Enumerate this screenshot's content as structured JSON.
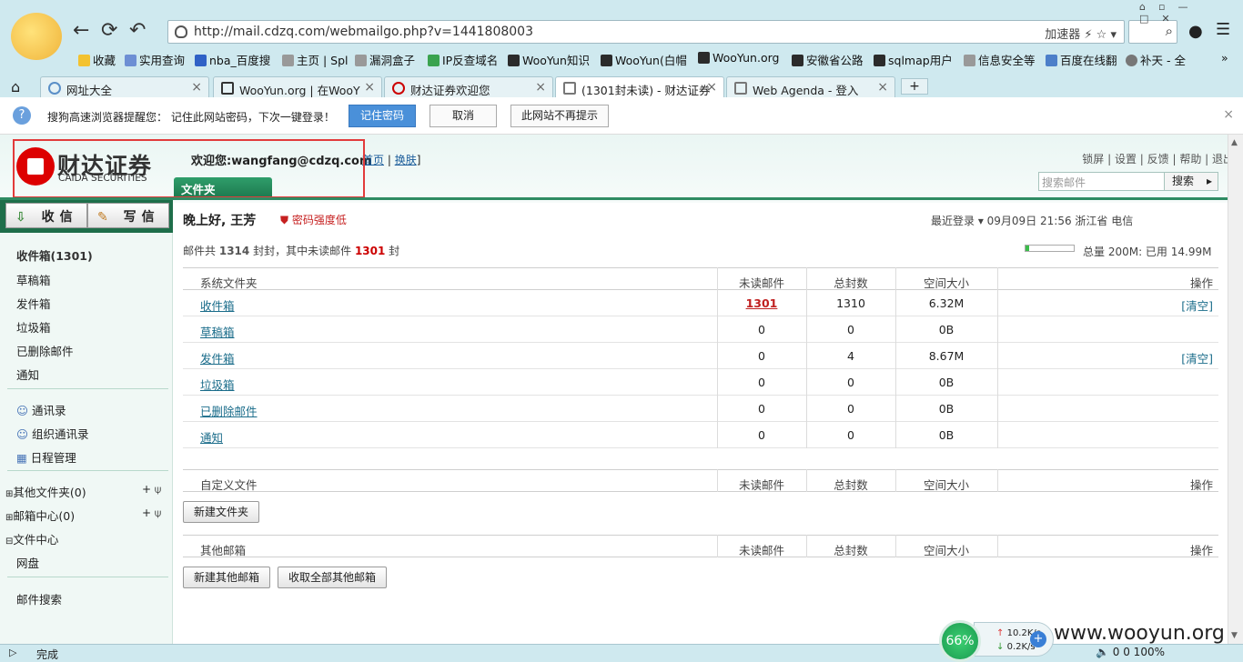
{
  "browser": {
    "url": "http://mail.cdzq.com/webmailgo.php?v=1441808003",
    "url_tools": "加速器 ⚡ ☆ ▾",
    "bookmarks": [
      "收藏",
      "实用查询",
      "nba_百度搜",
      "主页 | Spl",
      "漏洞盒子",
      "IP反查域名",
      "WooYun知识",
      "WooYun(白帽",
      "WooYun.org",
      "安徽省公路",
      "sqlmap用户",
      "信息安全等",
      "百度在线翻",
      "补天 - 全"
    ],
    "tabs": [
      {
        "label": "网址大全",
        "active": false
      },
      {
        "label": "WooYun.org | 在WooY",
        "active": false
      },
      {
        "label": "财达证券欢迎您",
        "active": false
      },
      {
        "label": "(1301封未读) - 财达证券",
        "active": true
      },
      {
        "label": "Web Agenda - 登入",
        "active": false
      }
    ],
    "notify": {
      "text": "搜狗高速浏览器提醒您：  记住此网站密码，下次一键登录！",
      "remember": "记住密码",
      "cancel": "取消",
      "never": "此网站不再提示"
    },
    "status": "完成",
    "net": {
      "percent": "66%",
      "up": "10.2K/s",
      "down": "0.2K/s"
    },
    "watermark": "www.wooyun.org",
    "status_right": "0   0   100%"
  },
  "header": {
    "logo_cn": "财达证券",
    "logo_en": "CAIDA SECURITIES",
    "welcome": "欢迎您:wangfang@cdzq.com",
    "home_link": "首页",
    "skin_link": "换肤",
    "folder_tab": "文件夹",
    "links": "锁屏 | 设置 | 反馈 | 帮助 | 退出",
    "search_placeholder": "搜索邮件",
    "search_btn": "搜索"
  },
  "sidebar": {
    "receive": "收信",
    "write": "写信",
    "folders": [
      "收件箱(1301)",
      "草稿箱",
      "发件箱",
      "垃圾箱",
      "已删除邮件",
      "通知"
    ],
    "tools": [
      "通讯录",
      "组织通讯录",
      "日程管理"
    ],
    "others": [
      "其他文件夹(0)",
      "邮箱中心(0)",
      "文件中心",
      "网盘"
    ],
    "mail_search": "邮件搜索"
  },
  "main": {
    "greeting": "晚上好, 王芳",
    "pw_warning": "密码强度低",
    "last_login": "最近登录 ▾ 09月09日 21:56 浙江省 电信",
    "count_prefix": "邮件共",
    "count_total": "1314",
    "count_mid": "封，其中未读邮件",
    "count_unread": "1301",
    "count_suffix": "封",
    "quota": "总量 200M: 已用 14.99M",
    "quota_used_fraction": 0.075,
    "sys_header": [
      "系统文件夹",
      "未读邮件",
      "总封数",
      "空间大小",
      "操作"
    ],
    "sys_rows": [
      {
        "name": "收件箱",
        "unread": "1301",
        "total": "1310",
        "size": "6.32M",
        "op": "[清空]"
      },
      {
        "name": "草稿箱",
        "unread": "0",
        "total": "0",
        "size": "0B",
        "op": ""
      },
      {
        "name": "发件箱",
        "unread": "0",
        "total": "4",
        "size": "8.67M",
        "op": "[清空]"
      },
      {
        "name": "垃圾箱",
        "unread": "0",
        "total": "0",
        "size": "0B",
        "op": ""
      },
      {
        "name": "已删除邮件",
        "unread": "0",
        "total": "0",
        "size": "0B",
        "op": ""
      },
      {
        "name": "通知",
        "unread": "0",
        "total": "0",
        "size": "0B",
        "op": ""
      }
    ],
    "custom_header": [
      "自定义文件",
      "未读邮件",
      "总封数",
      "空间大小",
      "操作"
    ],
    "new_folder_btn": "新建文件夹",
    "other_header": [
      "其他邮箱",
      "未读邮件",
      "总封数",
      "空间大小",
      "操作"
    ],
    "new_other_btn": "新建其他邮箱",
    "fetch_all_btn": "收取全部其他邮箱"
  }
}
